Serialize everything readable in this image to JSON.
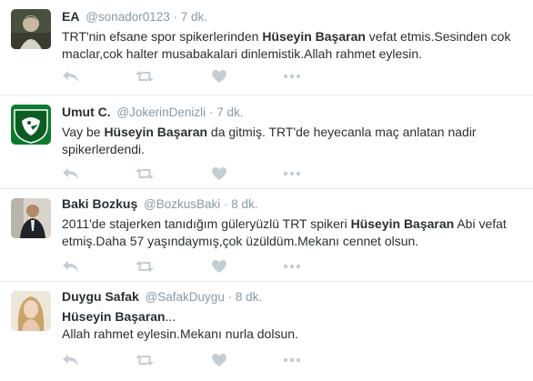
{
  "colors": {
    "text": "#292f33",
    "muted": "#8899a6",
    "action_icon": "#c2cdd4",
    "divider": "#e1e8ed"
  },
  "action_icons": [
    "reply-icon",
    "retweet-icon",
    "like-icon",
    "more-icon"
  ],
  "tweets": [
    {
      "name": "EA",
      "handle": "@sonador0123",
      "separator": "·",
      "time": "7 dk.",
      "text_parts": [
        "TRT'nin efsane spor spikerlerinden ",
        "Hüseyin Başaran",
        " vefat etmis.Sesinden cok maclar,cok halter musabakalari dinlemistik.Allah rahmet eylesin."
      ]
    },
    {
      "name": "Umut C.",
      "handle": "@JokerinDenizli",
      "separator": "·",
      "time": "7 dk.",
      "text_parts": [
        "Vay be ",
        "Hüseyin Başaran",
        " da gitmiş. TRT'de heyecanla maç anlatan nadir spikerlerdendi."
      ]
    },
    {
      "name": "Baki Bozkuş",
      "handle": "@BozkusBaki",
      "separator": "·",
      "time": "8 dk.",
      "text_parts": [
        "2011'de stajerken tanıdığım güleryüzlü TRT spikeri ",
        "Hüseyin Başaran",
        " Abi vefat etmiş.Daha 57 yaşındaymış,çok üzüldüm.Mekanı cennet olsun."
      ]
    },
    {
      "name": "Duygu Safak",
      "handle": "@SafakDuygu",
      "separator": "·",
      "time": "8 dk.",
      "text_parts": [
        "Hüseyin Başaran",
        "...",
        "Allah rahmet eylesin.Mekanı nurla dolsun."
      ]
    }
  ]
}
